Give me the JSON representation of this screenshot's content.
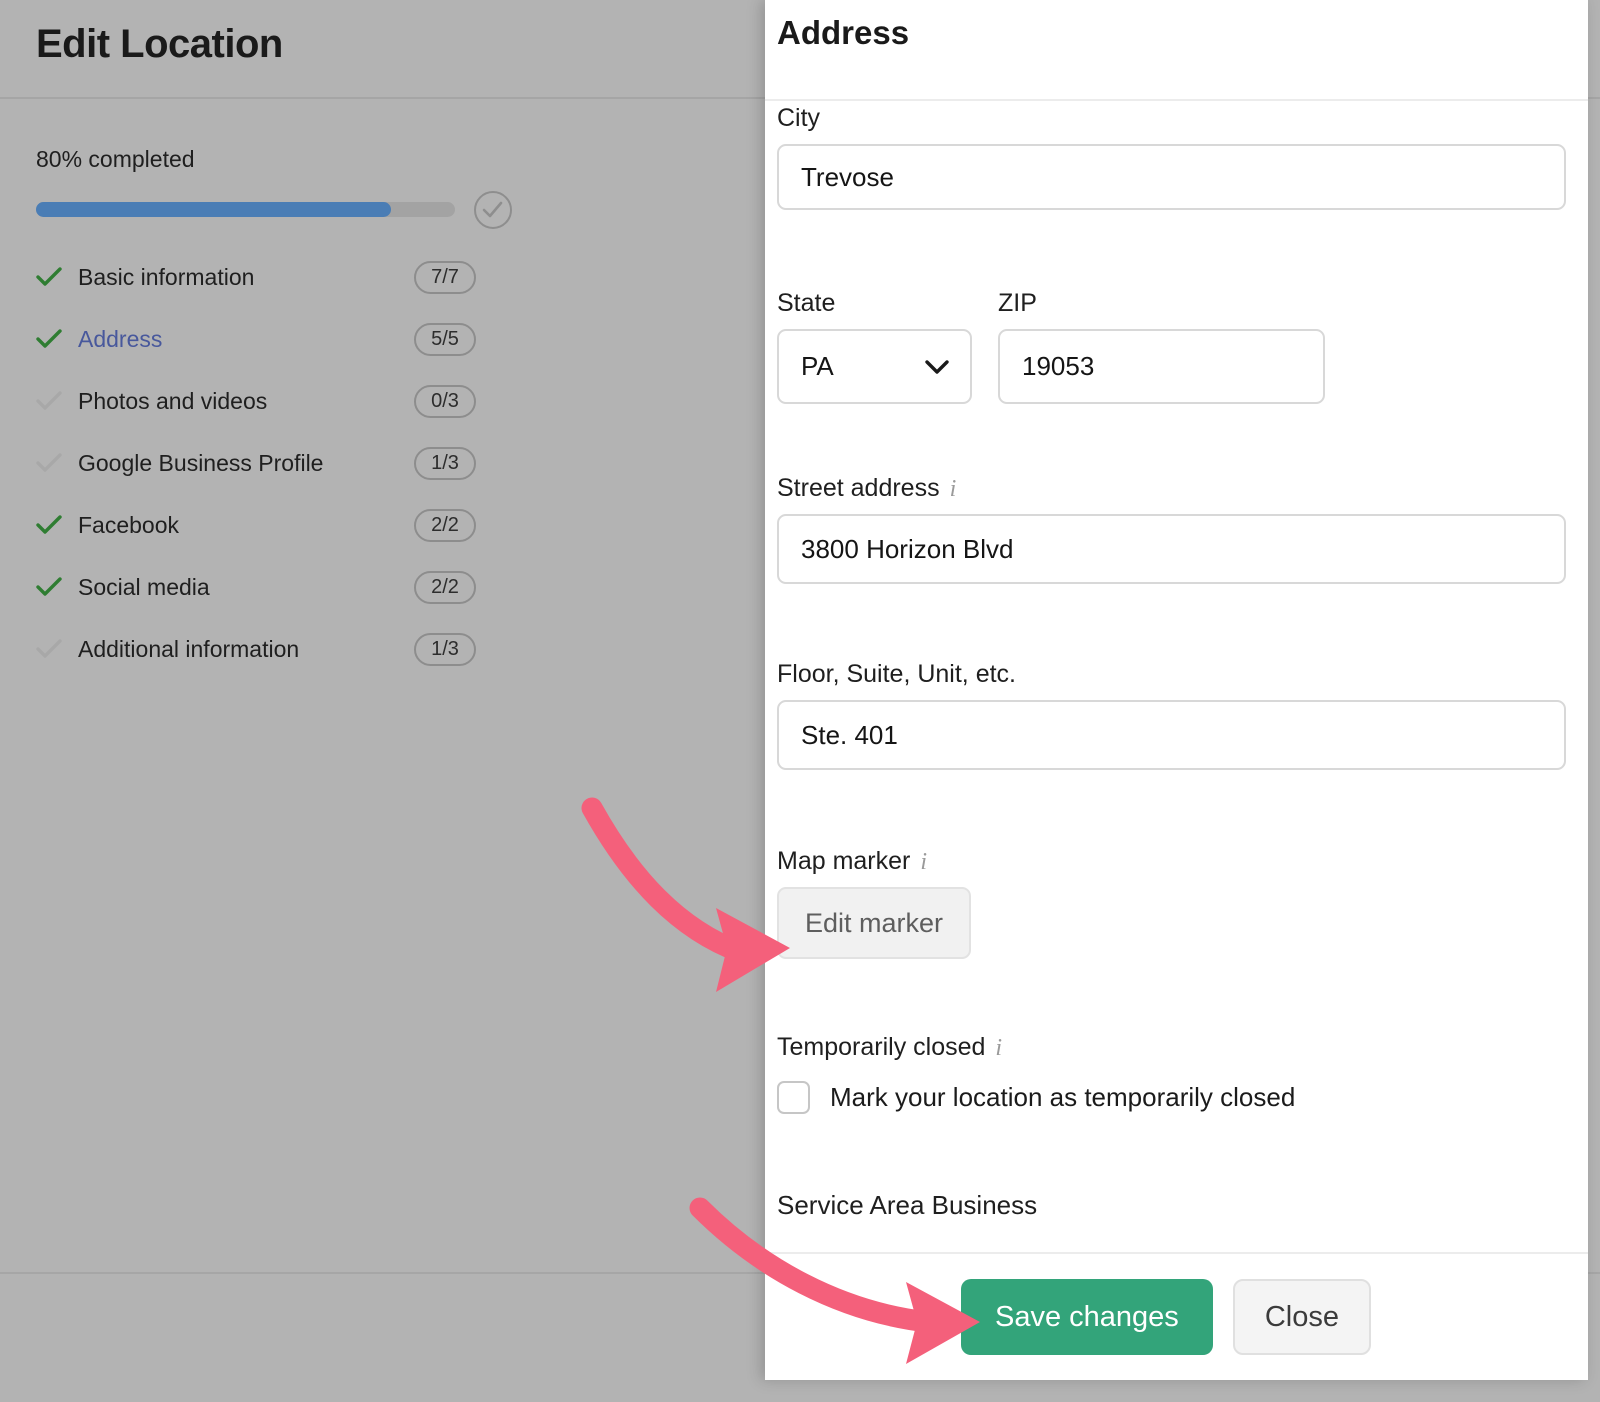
{
  "backdrop": {
    "title": "Edit Location",
    "progress": {
      "label": "80% completed",
      "percent": 80,
      "complete_icon": "check-circle-icon"
    },
    "checklist": [
      {
        "label": "Basic information",
        "badge": "7/7",
        "done": true,
        "active": false
      },
      {
        "label": "Address",
        "badge": "5/5",
        "done": true,
        "active": true
      },
      {
        "label": "Photos and videos",
        "badge": "0/3",
        "done": false,
        "active": false
      },
      {
        "label": "Google Business Profile",
        "badge": "1/3",
        "done": false,
        "active": false
      },
      {
        "label": "Facebook",
        "badge": "2/2",
        "done": true,
        "active": false
      },
      {
        "label": "Social media",
        "badge": "2/2",
        "done": true,
        "active": false
      },
      {
        "label": "Additional information",
        "badge": "1/3",
        "done": false,
        "active": false
      }
    ]
  },
  "panel": {
    "title": "Address",
    "fields": {
      "city": {
        "label": "City",
        "value": "Trevose"
      },
      "state": {
        "label": "State",
        "value": "PA",
        "chevron": "chevron-down-icon"
      },
      "zip": {
        "label": "ZIP",
        "value": "19053"
      },
      "street": {
        "label": "Street address",
        "value": "3800 Horizon Blvd",
        "info": "i"
      },
      "suite": {
        "label": "Floor, Suite, Unit, etc.",
        "value": "Ste. 401"
      },
      "marker": {
        "label": "Map marker",
        "info": "i",
        "button_label": "Edit marker"
      },
      "closed": {
        "label": "Temporarily closed",
        "info": "i",
        "checkbox_label": "Mark your location as temporarily closed",
        "checked": false
      },
      "service_area": {
        "label": "Service Area Business"
      }
    },
    "footer": {
      "save_label": "Save changes",
      "close_label": "Close"
    }
  },
  "colors": {
    "accent_blue": "#4a7db5",
    "link_blue": "#48589c",
    "check_green": "#2f7d32",
    "save_green": "#33a47a",
    "arrow_pink": "#f4607b",
    "overlay_gray": "#b3b3b3"
  }
}
